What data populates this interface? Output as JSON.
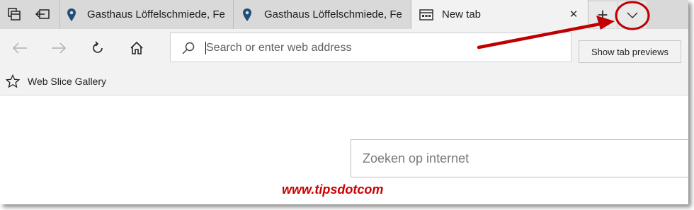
{
  "tabbar": {
    "set_aside_icon": "tabs-set-aside-icon",
    "restore_icon": "restore-tabs-icon",
    "tabs": [
      {
        "label": "Gasthaus Löffelschmiede, Fe",
        "icon": "map-pin-icon",
        "active": false
      },
      {
        "label": "Gasthaus Löffelschmiede, Fe",
        "icon": "map-pin-icon",
        "active": false
      },
      {
        "label": "New tab",
        "icon": "new-tab-page-icon",
        "active": true
      }
    ],
    "close_glyph": "✕",
    "new_tab_glyph": "+",
    "preview_glyph": "chevron-down-icon"
  },
  "navbar": {
    "back_icon": "back-arrow-icon",
    "forward_icon": "forward-arrow-icon",
    "refresh_icon": "refresh-icon",
    "home_icon": "home-icon",
    "address_placeholder": "Search or enter web address"
  },
  "tooltip": {
    "text": "Show tab previews"
  },
  "favorites": {
    "item_label": "Web Slice Gallery",
    "icon": "star-outline-icon"
  },
  "content": {
    "web_search_placeholder": "Zoeken op internet",
    "watermark": "www.tipsdotcom"
  },
  "colors": {
    "tabbar_bg": "#d9d9d9",
    "active_tab_bg": "#f2f2f2",
    "pin_blue": "#1f4e79",
    "annotation_red": "#c00000"
  }
}
